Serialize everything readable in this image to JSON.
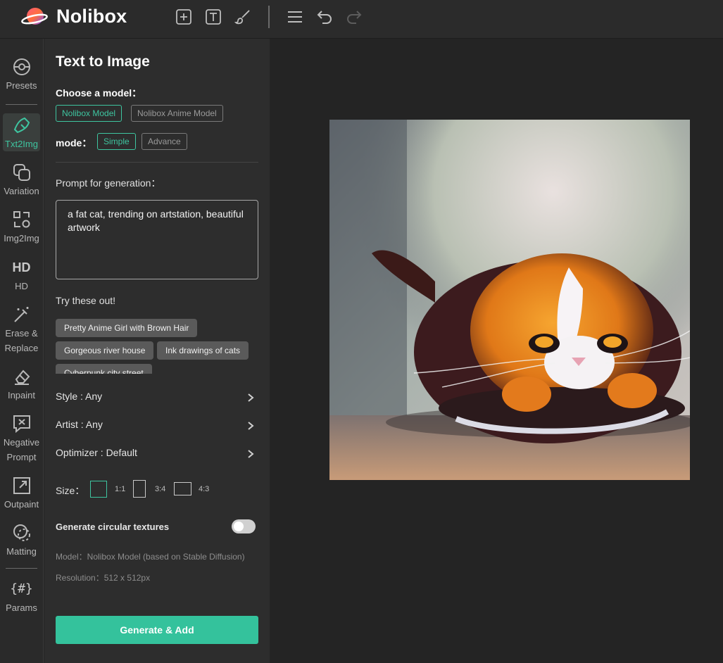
{
  "app": {
    "brand": "Nolibox"
  },
  "toolbar": {
    "icons": [
      "add-square-icon",
      "text-tool-icon",
      "brush-icon",
      "menu-icon",
      "undo-icon",
      "redo-icon"
    ]
  },
  "rail": {
    "items": [
      {
        "label": "Presets",
        "icon": "presets-icon",
        "active": false
      },
      {
        "label": "Txt2Img",
        "icon": "txt2img-icon",
        "active": true
      },
      {
        "label": "Variation",
        "icon": "variation-icon",
        "active": false
      },
      {
        "label": "Img2Img",
        "icon": "img2img-icon",
        "active": false
      },
      {
        "label": "HD",
        "icon": "hd-icon",
        "active": false
      },
      {
        "label_1": "Erase &",
        "label_2": "Replace",
        "icon": "magic-wand-icon",
        "active": false
      },
      {
        "label": "Inpaint",
        "icon": "eraser-icon",
        "active": false
      },
      {
        "label_1": "Negative",
        "label_2": "Prompt",
        "icon": "negative-prompt-icon",
        "active": false
      },
      {
        "label": "Outpaint",
        "icon": "outpaint-icon",
        "active": false
      },
      {
        "label": "Matting",
        "icon": "matting-icon",
        "active": false
      },
      {
        "label": "Params",
        "icon": "params-icon",
        "active": false
      }
    ],
    "params_glyph": "{#}",
    "hd_glyph": "HD"
  },
  "panel": {
    "title": "Text to Image",
    "model_label": "Choose a model：",
    "models": [
      "Nolibox Model",
      "Nolibox Anime Model"
    ],
    "selected_model": "Nolibox Model",
    "mode_label": "mode：",
    "modes": [
      "Simple",
      "Advance"
    ],
    "selected_mode": "Simple",
    "prompt_label": "Prompt for generation：",
    "prompt_value": "a fat cat, trending on artstation, beautiful artwork",
    "try_label": "Try these out!",
    "suggestions": [
      "Pretty Anime Girl with Brown Hair",
      "Gorgeous river house",
      "Ink drawings of cats",
      "Cyberpunk city street"
    ],
    "style_row": "Style : Any",
    "artist_row": "Artist : Any",
    "optimizer_row": "Optimizer : Default",
    "size_label": "Size：",
    "sizes": [
      "1:1",
      "3:4",
      "4:3"
    ],
    "selected_size": "1:1",
    "circular_label": "Generate circular textures",
    "circular_enabled": false,
    "model_meta": "Model：Nolibox Model (based on Stable Diffusion)",
    "resolution_meta": "Resolution：512 x 512px",
    "generate_label": "Generate & Add"
  },
  "colors": {
    "accent": "#34c29c",
    "accent_text": "#3ec5a0",
    "panel_bg": "#2d2d2d",
    "canvas_bg": "#242424"
  }
}
